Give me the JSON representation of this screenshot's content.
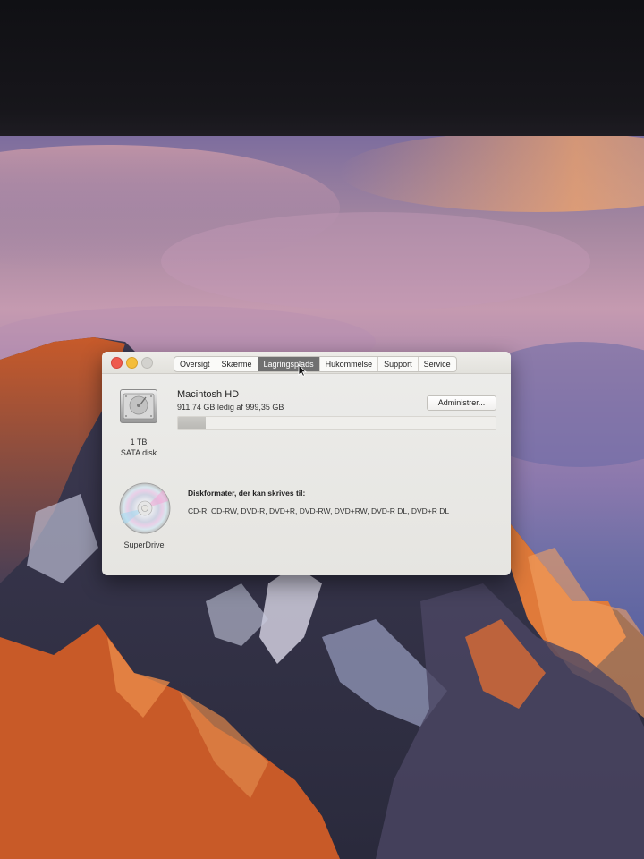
{
  "window": {
    "tabs": [
      {
        "label": "Oversigt",
        "active": false
      },
      {
        "label": "Skærme",
        "active": false
      },
      {
        "label": "Lagringsplads",
        "active": true
      },
      {
        "label": "Hukommelse",
        "active": false
      },
      {
        "label": "Support",
        "active": false
      },
      {
        "label": "Service",
        "active": false
      }
    ]
  },
  "disk": {
    "name": "Macintosh HD",
    "free_text": "911,74 GB ledig af 999,35 GB",
    "capacity_label": "1 TB",
    "type_label": "SATA disk",
    "manage_label": "Administrer...",
    "used_fraction": 0.088,
    "icon": "hard-disk-icon"
  },
  "superdrive": {
    "label": "SuperDrive",
    "formats_title": "Diskformater, der kan skrives til:",
    "formats": "CD-R, CD-RW, DVD-R, DVD+R, DVD-RW, DVD+RW, DVD-R DL, DVD+R DL",
    "icon": "optical-disc-icon"
  },
  "colors": {
    "active_tab": "#707070",
    "close": "#ee5a4f",
    "minimize": "#f4bd3a"
  }
}
